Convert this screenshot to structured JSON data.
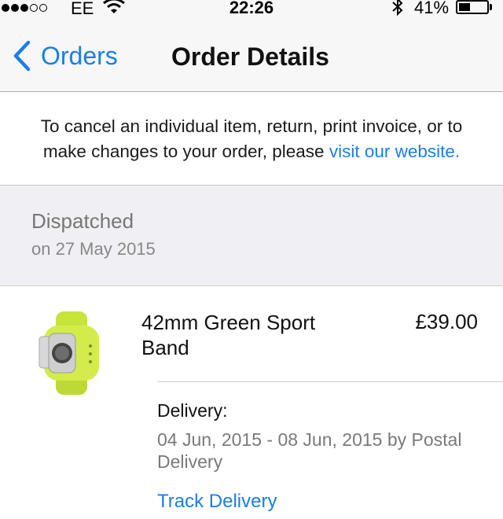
{
  "status_bar": {
    "carrier": "EE",
    "time": "22:26",
    "battery": "41%",
    "battery_level": 0.41,
    "signal_bars": 3
  },
  "nav": {
    "back_label": "Orders",
    "title": "Order Details"
  },
  "notice": {
    "text": "To cancel an individual item, return, print invoice, or to make changes to your order, please ",
    "link": "visit our website."
  },
  "shipment": {
    "status": "Dispatched",
    "date": "on 27 May 2015"
  },
  "item": {
    "name": "42mm Green Sport Band",
    "price": "£39.00",
    "delivery_label": "Delivery:",
    "delivery_dates": "04 Jun, 2015 - 08 Jun, 2015 by Postal Delivery",
    "track_label": "Track Delivery"
  },
  "colors": {
    "link_blue": "#1a7ee8",
    "band_green": "#c6e43a"
  },
  "icons": [
    "signal-icon",
    "wifi-icon",
    "bluetooth-icon",
    "battery-icon",
    "chevron-left-icon",
    "watch-band-thumbnail"
  ]
}
